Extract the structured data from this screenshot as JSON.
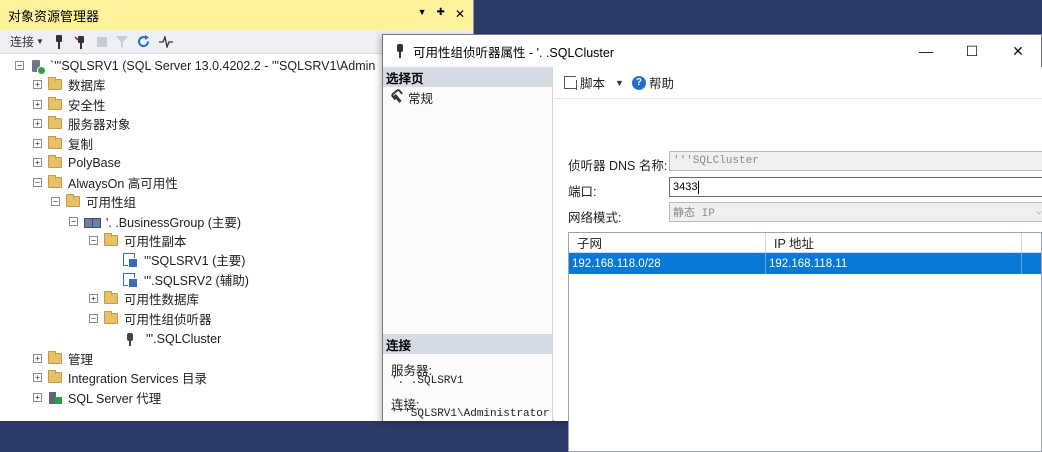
{
  "object_explorer": {
    "title": "对象资源管理器",
    "title_controls": [
      "▼",
      "✚",
      "✕"
    ],
    "toolbar": {
      "connect_label": "连接"
    },
    "tree": [
      {
        "label": "`'''SQLSRV1 (SQL Server 13.0.4202.2 - '''SQLSRV1\\Admin",
        "expander": "−",
        "icon": "server-icon"
      },
      {
        "label": "数据库",
        "expander": "+",
        "icon": "folder-icon"
      },
      {
        "label": "安全性",
        "expander": "+",
        "icon": "folder-icon"
      },
      {
        "label": "服务器对象",
        "expander": "+",
        "icon": "folder-icon"
      },
      {
        "label": "复制",
        "expander": "+",
        "icon": "folder-icon"
      },
      {
        "label": "PolyBase",
        "expander": "+",
        "icon": "folder-icon"
      },
      {
        "label": "AlwaysOn 高可用性",
        "expander": "−",
        "icon": "folder-icon"
      },
      {
        "label": "可用性组",
        "expander": "−",
        "icon": "folder-icon"
      },
      {
        "label": "'. .BusinessGroup (主要)",
        "expander": "−",
        "icon": "availability-group-icon"
      },
      {
        "label": "可用性副本",
        "expander": "−",
        "icon": "folder-icon"
      },
      {
        "label": "'''SQLSRV1 (主要)",
        "expander": "",
        "icon": "replica-icon"
      },
      {
        "label": "'''.SQLSRV2 (辅助)",
        "expander": "",
        "icon": "replica-icon"
      },
      {
        "label": "可用性数据库",
        "expander": "+",
        "icon": "folder-icon"
      },
      {
        "label": "可用性组侦听器",
        "expander": "−",
        "icon": "folder-icon"
      },
      {
        "label": "'''.SQLCluster",
        "expander": "",
        "icon": "listener-icon"
      },
      {
        "label": "管理",
        "expander": "+",
        "icon": "folder-icon"
      },
      {
        "label": "Integration Services 目录",
        "expander": "+",
        "icon": "folder-icon"
      },
      {
        "label": "SQL Server 代理",
        "expander": "+",
        "icon": "sql-agent-icon"
      }
    ]
  },
  "dialog": {
    "title": "可用性组侦听器属性 - '. .SQLCluster",
    "window_buttons": {
      "minimize": "—",
      "maximize": "☐",
      "close": "✕"
    },
    "left_pane": {
      "select_page_header": "选择页",
      "pages": [
        "常规"
      ],
      "connection_header": "连接",
      "server_label": "服务器:",
      "server_value": "'. .SQLSRV1",
      "connection_label": "连接:",
      "connection_value": "'''SQLSRV1\\Administrator"
    },
    "toolbar": {
      "script_label": "脚本",
      "help_label": "帮助"
    },
    "form": {
      "dns_label": "侦听器 DNS 名称:",
      "dns_value": "'''SQLCluster",
      "port_label": "端口:",
      "port_value": "3433",
      "network_mode_label": "网络模式:",
      "network_mode_value": "静态 IP"
    },
    "grid": {
      "columns": [
        "子网",
        "IP 地址"
      ],
      "rows": [
        {
          "subnet": "192.168.118.0/28",
          "ip": "192.168.118.11"
        }
      ]
    }
  },
  "colors": {
    "oe_title_bg": "#fff29d",
    "desktop_bg": "#2b3a67",
    "selection_blue": "#0a78d7",
    "pane_header_bg": "#d5dbe5"
  }
}
